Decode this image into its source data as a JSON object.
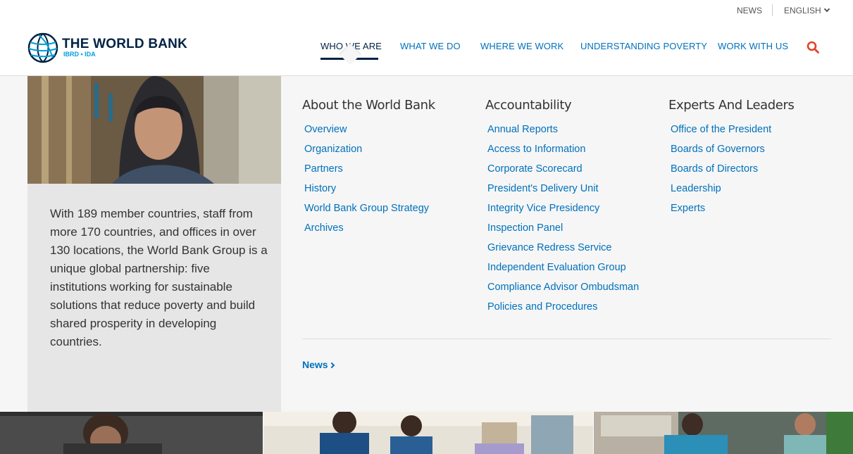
{
  "utility": {
    "news": "NEWS",
    "language": "ENGLISH"
  },
  "logo": {
    "title": "THE WORLD BANK",
    "subtitle": "IBRD • IDA"
  },
  "nav": {
    "items": [
      {
        "label": "WHO WE ARE",
        "active": true
      },
      {
        "label": "WHAT WE DO"
      },
      {
        "label": "WHERE WE WORK"
      },
      {
        "label": "UNDERSTANDING POVERTY"
      },
      {
        "label": "WORK WITH US"
      }
    ],
    "search_icon": "search-icon"
  },
  "mega": {
    "description": "With 189 member countries, staff from more 170 countries, and offices in over 130 locations, the World Bank Group is a unique global partnership: five institutions working for sustainable solutions that reduce poverty and build shared prosperity in developing countries.",
    "columns": [
      {
        "title": "About the World Bank",
        "links": [
          "Overview",
          "Organization",
          "Partners",
          "History",
          "World Bank Group Strategy",
          "Archives"
        ]
      },
      {
        "title": "Accountability",
        "links": [
          "Annual Reports",
          "Access to Information",
          "Corporate Scorecard",
          "President's Delivery Unit",
          "Integrity Vice Presidency",
          "Inspection Panel",
          "Grievance Redress Service",
          "Independent Evaluation Group",
          "Compliance Advisor Ombudsman",
          "Policies and Procedures"
        ]
      },
      {
        "title": "Experts And Leaders",
        "links": [
          "Office of the President",
          "Boards of Governors",
          "Boards of Directors",
          "Leadership",
          "Experts"
        ]
      }
    ],
    "news_link": "News"
  },
  "colors": {
    "brand_navy": "#002244",
    "brand_cyan": "#009fda",
    "link_blue": "#0071bc",
    "search_red": "#e0452a"
  }
}
